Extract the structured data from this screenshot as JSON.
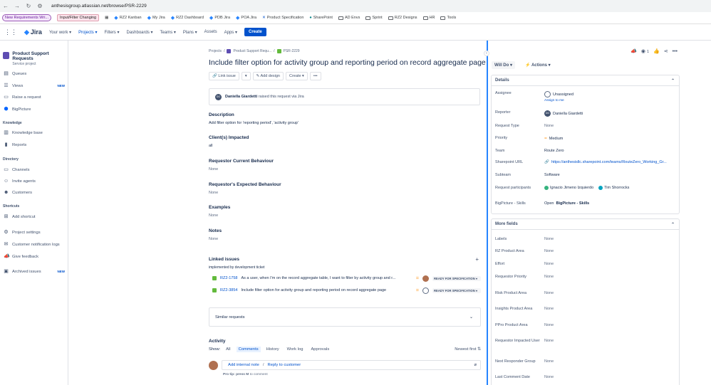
{
  "browser": {
    "url": "anthesisgroup.atlassian.net/browse/PSR-2229",
    "bookmarks": [
      "New Requirements Wri...",
      "Input/Filter Changing",
      "RZ2 Kanban",
      "My Jira",
      "RZ2 Dashboard",
      "PDB Jira",
      "POA Jira",
      "Product Specification",
      "SharePoint",
      "AD Envs",
      "Sprint",
      "RZ2 Designs",
      "HR",
      "Tools"
    ]
  },
  "topnav": {
    "logo": "Jira",
    "items": [
      "Your work",
      "Projects",
      "Filters",
      "Dashboards",
      "Teams",
      "Plans",
      "Assets",
      "Apps"
    ],
    "create": "Create"
  },
  "sidebar": {
    "project_name": "Product Support Requests",
    "project_type": "Service project",
    "items": [
      {
        "label": "Queues"
      },
      {
        "label": "Views",
        "badge": "NEW"
      },
      {
        "label": "Raise a request"
      },
      {
        "label": "BigPicture"
      }
    ],
    "knowledge_head": "Knowledge",
    "knowledge_items": [
      "Knowledge base",
      "Reports"
    ],
    "directory_head": "Directory",
    "directory_items": [
      "Channels",
      "Invite agents",
      "Customers"
    ],
    "shortcuts_head": "Shortcuts",
    "shortcut_items": [
      "Add shortcut"
    ],
    "bottom_items": [
      "Project settings",
      "Customer notification logs",
      "Give feedback"
    ],
    "archived": {
      "label": "Archived issues",
      "badge": "NEW"
    }
  },
  "issue": {
    "breadcrumb": [
      "Projects",
      "/",
      "Product Support Requ...",
      "/",
      "PSR-2229"
    ],
    "title": "Include filter option for activity group and reporting period on record aggregate page",
    "actions": [
      "Link issue",
      "Add design",
      "Create"
    ],
    "raised_by": "Daniella Giardetti",
    "raised_text": "raised this request via Jira",
    "fields": [
      {
        "label": "Description",
        "value": "Add filter option for 'reporting period', 'activity group'"
      },
      {
        "label": "Client(s) Impacted",
        "value": "all"
      },
      {
        "label": "Requestor Current Behaviour",
        "value": "None"
      },
      {
        "label": "Requestor's Expected Behaviour",
        "value": "None"
      },
      {
        "label": "Examples",
        "value": "None"
      },
      {
        "label": "Notes",
        "value": "None"
      }
    ],
    "linked": {
      "label": "Linked issues",
      "relation": "implemented by development ticket",
      "rows": [
        {
          "key": "RZ2-1758",
          "summary": "As a user, when I'm on the record aggregate table, I want to filter by activity group and r...",
          "status": "READY FOR SPECIFICATION"
        },
        {
          "key": "RZ2-3854",
          "summary": "Include filter option for activity group and reporting period on record aggregate page",
          "status": "READY FOR SPECIFICATION"
        }
      ]
    },
    "similar": "Similar requests",
    "activity": {
      "label": "Activity",
      "show": "Show:",
      "tabs": [
        "All",
        "Comments",
        "History",
        "Work log",
        "Approvals"
      ],
      "sort": "Newest first",
      "add_internal": "Add internal note",
      "reply": "Reply to customer",
      "protip_a": "Pro tip: press",
      "protip_key": "M",
      "protip_b": "to comment"
    }
  },
  "right": {
    "watch_count": "1",
    "status": "Will Do",
    "actions": "Actions",
    "details_head": "Details",
    "details": [
      {
        "k": "Assignee",
        "v": "Unassigned",
        "extra": "Assign to me"
      },
      {
        "k": "Reporter",
        "v": "Daniella Giardetti"
      },
      {
        "k": "Request Type",
        "v": "None"
      },
      {
        "k": "Priority",
        "v": "Medium"
      },
      {
        "k": "Team",
        "v": "Route Zero"
      },
      {
        "k": "Sharepoint URL",
        "v": "https://anthesisllc.sharepoint.com/teams/RouteZero_Working_Gr..."
      },
      {
        "k": "Subteam",
        "v": "Software"
      },
      {
        "k": "Request participants",
        "v": "Ignacio Jimeno Izquierdo",
        "v2": "Tim Shorrocks"
      },
      {
        "k": "BigPicture - Skills",
        "v": "Open",
        "v_bold": "BigPicture - Skills"
      }
    ],
    "more_head": "More fields",
    "more": [
      {
        "k": "Labels",
        "v": "None"
      },
      {
        "k": "RZ Product Area",
        "v": "None"
      },
      {
        "k": "Effort",
        "v": "None"
      },
      {
        "k": "Requestor Priority",
        "v": "None"
      },
      {
        "k": "Risk Product Area",
        "v": "None"
      },
      {
        "k": "Insights Product Area",
        "v": "None"
      },
      {
        "k": "PPro Product Area",
        "v": "None"
      },
      {
        "k": "Requestor Impacted User",
        "v": "None"
      },
      {
        "k": "Next Responder Group",
        "v": "None"
      },
      {
        "k": "Last Comment Date",
        "v": "None"
      }
    ]
  }
}
